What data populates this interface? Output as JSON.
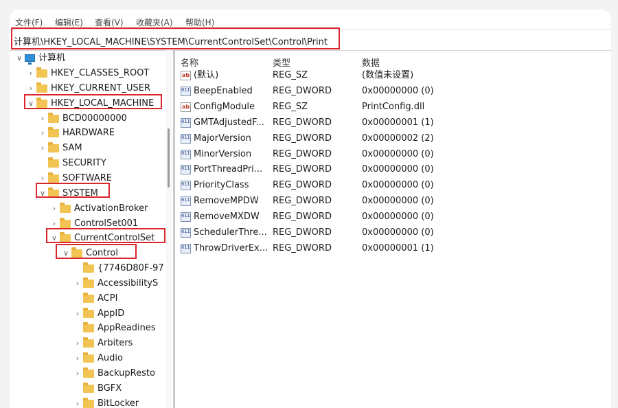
{
  "menu": [
    "文件(F)",
    "编辑(E)",
    "查看(V)",
    "收藏夹(A)",
    "帮助(H)"
  ],
  "address": "计算机\\HKEY_LOCAL_MACHINE\\SYSTEM\\CurrentControlSet\\Control\\Print",
  "tree": {
    "root": "计算机",
    "items": [
      {
        "label": "HKEY_CLASSES_ROOT",
        "expander": ">"
      },
      {
        "label": "HKEY_CURRENT_USER",
        "expander": ">"
      },
      {
        "label": "HKEY_LOCAL_MACHINE",
        "expander": "v"
      },
      {
        "label": "BCD00000000",
        "expander": ">"
      },
      {
        "label": "HARDWARE",
        "expander": ">"
      },
      {
        "label": "SAM",
        "expander": ">"
      },
      {
        "label": "SECURITY",
        "expander": ""
      },
      {
        "label": "SOFTWARE",
        "expander": ">"
      },
      {
        "label": "SYSTEM",
        "expander": "v"
      },
      {
        "label": "ActivationBroker",
        "expander": ">"
      },
      {
        "label": "ControlSet001",
        "expander": ">"
      },
      {
        "label": "CurrentControlSet",
        "expander": "v"
      },
      {
        "label": "Control",
        "expander": "v"
      },
      {
        "label": "{7746D80F-97",
        "expander": ""
      },
      {
        "label": "AccessibilityS",
        "expander": ">"
      },
      {
        "label": "ACPI",
        "expander": ""
      },
      {
        "label": "AppID",
        "expander": ">"
      },
      {
        "label": "AppReadines",
        "expander": ""
      },
      {
        "label": "Arbiters",
        "expander": ">"
      },
      {
        "label": "Audio",
        "expander": ">"
      },
      {
        "label": "BackupResto",
        "expander": ">"
      },
      {
        "label": "BGFX",
        "expander": ""
      },
      {
        "label": "BitLocker",
        "expander": ">"
      }
    ]
  },
  "columns": {
    "name": "名称",
    "type": "类型",
    "data": "数据"
  },
  "values": [
    {
      "icon": "string-value-icon",
      "name": "(默认)",
      "type": "REG_SZ",
      "data": "(数值未设置)"
    },
    {
      "icon": "binary-value-icon",
      "name": "BeepEnabled",
      "type": "REG_DWORD",
      "data": "0x00000000 (0)"
    },
    {
      "icon": "string-value-icon",
      "name": "ConfigModule",
      "type": "REG_SZ",
      "data": "PrintConfig.dll"
    },
    {
      "icon": "binary-value-icon",
      "name": "GMTAdjustedF...",
      "type": "REG_DWORD",
      "data": "0x00000001 (1)"
    },
    {
      "icon": "binary-value-icon",
      "name": "MajorVersion",
      "type": "REG_DWORD",
      "data": "0x00000002 (2)"
    },
    {
      "icon": "binary-value-icon",
      "name": "MinorVersion",
      "type": "REG_DWORD",
      "data": "0x00000000 (0)"
    },
    {
      "icon": "binary-value-icon",
      "name": "PortThreadPri...",
      "type": "REG_DWORD",
      "data": "0x00000000 (0)"
    },
    {
      "icon": "binary-value-icon",
      "name": "PriorityClass",
      "type": "REG_DWORD",
      "data": "0x00000000 (0)"
    },
    {
      "icon": "binary-value-icon",
      "name": "RemoveMPDW",
      "type": "REG_DWORD",
      "data": "0x00000000 (0)"
    },
    {
      "icon": "binary-value-icon",
      "name": "RemoveMXDW",
      "type": "REG_DWORD",
      "data": "0x00000000 (0)"
    },
    {
      "icon": "binary-value-icon",
      "name": "SchedulerThre...",
      "type": "REG_DWORD",
      "data": "0x00000000 (0)"
    },
    {
      "icon": "binary-value-icon",
      "name": "ThrowDriverEx...",
      "type": "REG_DWORD",
      "data": "0x00000001 (1)"
    }
  ],
  "colors": {
    "highlight": "#d9262c",
    "folder": "#f2c453"
  }
}
